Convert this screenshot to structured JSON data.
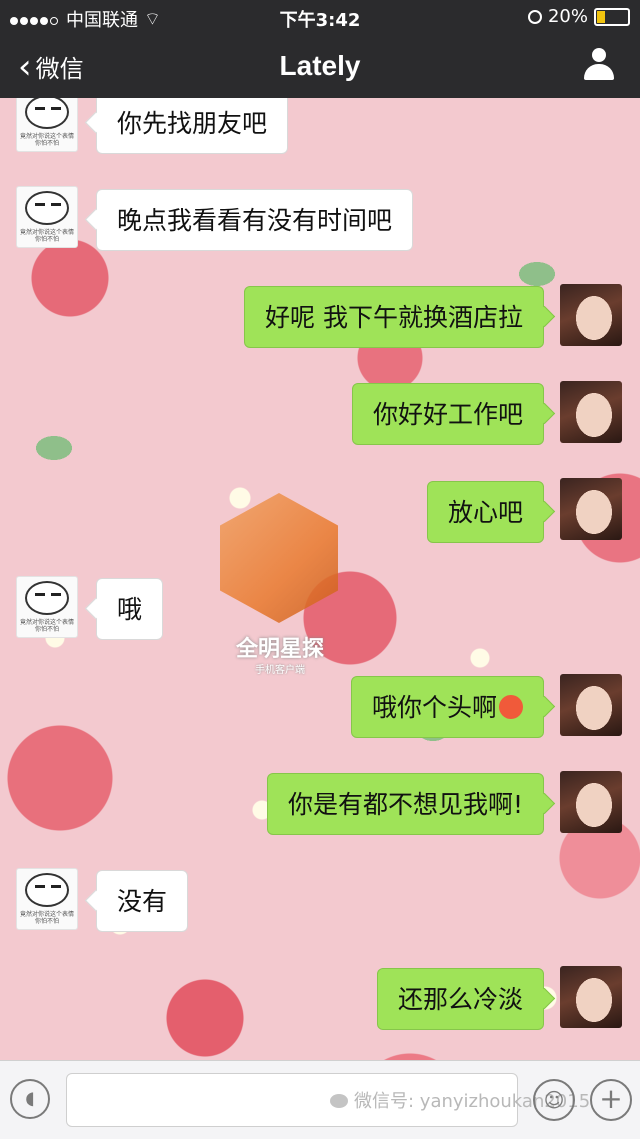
{
  "status_bar": {
    "carrier": "中国联通",
    "time": "下午3:42",
    "battery": "20%"
  },
  "nav": {
    "back_label": "微信",
    "title": "Lately"
  },
  "messages": [
    {
      "side": "left",
      "text": "你先找朋友吧"
    },
    {
      "side": "left",
      "text": "晚点我看看有没有时间吧"
    },
    {
      "side": "right",
      "text": "好呢 我下午就换酒店拉"
    },
    {
      "side": "right",
      "text": "你好好工作吧"
    },
    {
      "side": "right",
      "text": "放心吧"
    },
    {
      "side": "left",
      "text": "哦"
    },
    {
      "side": "right",
      "text": "哦你个头啊"
    },
    {
      "side": "right",
      "text": "你是有都不想见我啊!"
    },
    {
      "side": "left",
      "text": "没有"
    },
    {
      "side": "right",
      "text": "还那么冷淡"
    }
  ],
  "panda_avatar_caption": "竟然对你说这个表情 你怕不怕",
  "watermark": {
    "title": "全明星探",
    "subtitle": "手机客户端"
  },
  "input_bar": {
    "value": "",
    "wechat_watermark": "微信号: yanyizhoukan2015"
  },
  "colors": {
    "bar_bg": "#2b2b2d",
    "bubble_out": "#9fe358",
    "bubble_in": "#ffffff",
    "chat_bg": "#f3c9cf"
  }
}
